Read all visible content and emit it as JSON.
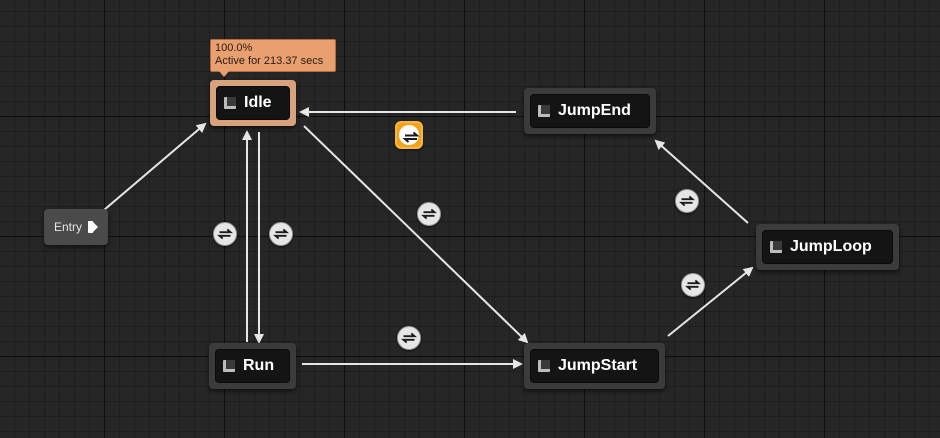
{
  "graph": {
    "entry": {
      "label": "Entry"
    },
    "states": {
      "idle": {
        "label": "Idle"
      },
      "jump_end": {
        "label": "JumpEnd"
      },
      "jump_loop": {
        "label": "JumpLoop"
      },
      "run": {
        "label": "Run"
      },
      "jump_start": {
        "label": "JumpStart"
      }
    },
    "active_tooltip": {
      "weight": "100.0%",
      "status": "Active for 213.37 secs"
    },
    "transitions": [
      {
        "from": "Entry",
        "to": "Idle"
      },
      {
        "from": "Idle",
        "to": "Run"
      },
      {
        "from": "Run",
        "to": "Idle"
      },
      {
        "from": "Idle",
        "to": "JumpStart"
      },
      {
        "from": "Run",
        "to": "JumpStart"
      },
      {
        "from": "JumpStart",
        "to": "JumpLoop"
      },
      {
        "from": "JumpLoop",
        "to": "JumpEnd"
      },
      {
        "from": "JumpEnd",
        "to": "Idle",
        "highlighted": true
      }
    ],
    "colors": {
      "background": "#262626",
      "node": "#3b3b3b",
      "active_node": "#d9a27d",
      "wire": "#e6e6e6",
      "highlight": "#f2a31b"
    },
    "icons": {
      "state": "state-machine-state-icon",
      "rule": "transition-rule-icon",
      "entry": "entry-pin-icon"
    }
  }
}
